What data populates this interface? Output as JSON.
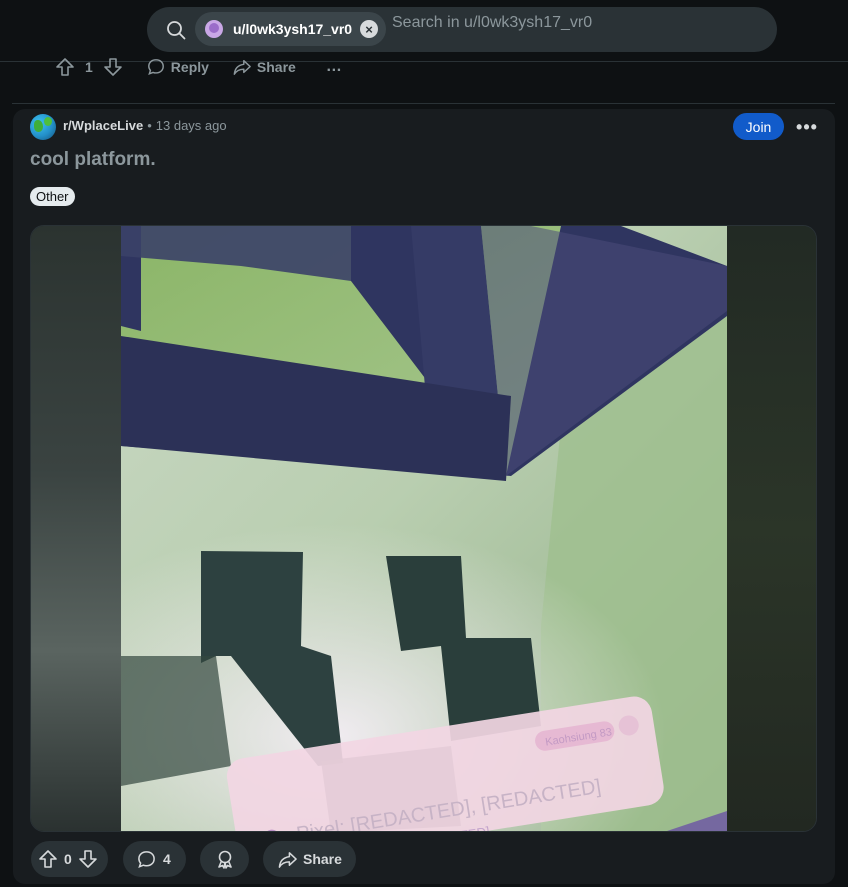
{
  "search": {
    "scope_chip_label": "u/l0wk3ysh17_vr0",
    "placeholder": "Search in u/l0wk3ysh17_vr0"
  },
  "previous_comment_bar": {
    "vote_count": "1",
    "reply_label": "Reply",
    "share_label": "Share",
    "more_label": "…"
  },
  "post": {
    "subreddit": "r/WplaceLive",
    "separator": "•",
    "age": "13 days ago",
    "join_label": "Join",
    "more_label": "•••",
    "title": "cool platform.",
    "flair": "Other",
    "photo_overlay": {
      "pixel_text": "Pixel: [REDACTED], [REDACTED]",
      "badge_text": "Kaohsiung 83",
      "sub_text": "[REDACTED] [REDACTED]"
    },
    "vote_count": "0",
    "comment_count": "4",
    "share_label": "Share"
  },
  "colors": {
    "background": "#0e1113",
    "card": "#181c1f",
    "join_button": "#115bca",
    "pill": "#2a3236",
    "muted_text": "#8c979c"
  }
}
